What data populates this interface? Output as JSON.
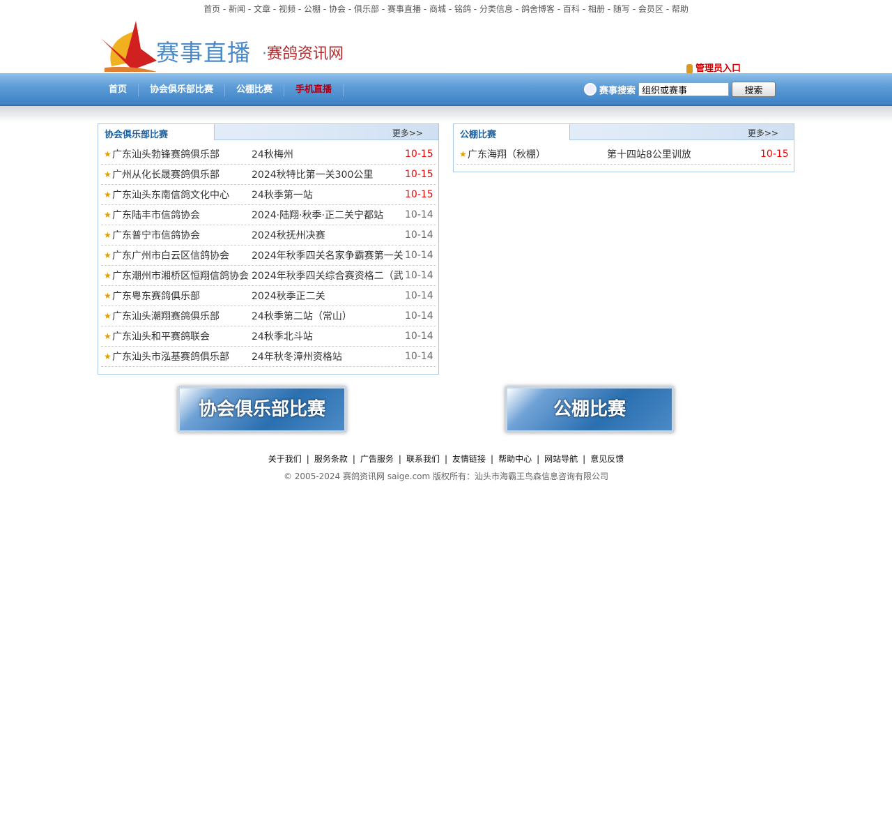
{
  "top_links": [
    "首页",
    "新闻",
    "文章",
    "视频",
    "公棚",
    "协会",
    "俱乐部",
    "赛事直播",
    "商城",
    "铭鸽",
    "分类信息",
    "鸽舍博客",
    "百科",
    "相册",
    "随写",
    "会员区",
    "帮助"
  ],
  "logo": {
    "title": "赛事直播",
    "dot": "·",
    "site": "赛鸽资讯网"
  },
  "admin_link": "管理员入口",
  "nav": [
    "首页",
    "协会俱乐部比赛",
    "公棚比赛",
    "手机直播"
  ],
  "search": {
    "label": "赛事搜索",
    "value": "组织或赛事",
    "button": "搜索"
  },
  "left_panel": {
    "title": "协会俱乐部比赛",
    "more": "更多>>",
    "rows": [
      [
        "广东汕头勃锋赛鸽俱乐部",
        "24秋梅州",
        "10-15"
      ],
      [
        "广州从化长晟赛鸽俱乐部",
        "2024秋特比第一关300公里",
        "10-15"
      ],
      [
        "广东汕头东南信鸽文化中心",
        "24秋季第一站",
        "10-15"
      ],
      [
        "广东陆丰市信鸽协会",
        "2024·陆翔·秋季·正二关宁都站",
        "10-14"
      ],
      [
        "广东普宁市信鸽协会",
        "2024秋抚州决赛",
        "10-14"
      ],
      [
        "广东广州市白云区信鸽协会",
        "2024年秋季四关名家争霸赛第一关",
        "10-14"
      ],
      [
        "广东潮州市湘桥区恒翔信鸽协会",
        "2024年秋季四关综合赛资格二（武",
        "10-14"
      ],
      [
        "广东粤东赛鸽俱乐部",
        "2024秋季正二关",
        "10-14"
      ],
      [
        "广东汕头潮翔赛鸽俱乐部",
        "24秋季第二站（常山）",
        "10-14"
      ],
      [
        "广东汕头和平赛鸽联会",
        "24秋季北斗站",
        "10-14"
      ],
      [
        "广东汕头市泓基赛鸽俱乐部",
        "24年秋冬漳州资格站",
        "10-14"
      ]
    ]
  },
  "right_panel": {
    "title": "公棚比赛",
    "more": "更多>>",
    "rows": [
      [
        "广东海翔（秋棚）",
        "第十四站8公里训放",
        "10-15"
      ]
    ]
  },
  "banners": [
    "协会俱乐部比赛",
    "公棚比赛"
  ],
  "footer_links": [
    "关于我们",
    "服务条款",
    "广告服务",
    "联系我们",
    "友情链接",
    "帮助中心",
    "网站导航",
    "意见反馈"
  ],
  "copyright": "© 2005-2024 赛鸽资讯网 saige.com 版权所有：汕头市海霸王鸟森信息咨询有限公司"
}
